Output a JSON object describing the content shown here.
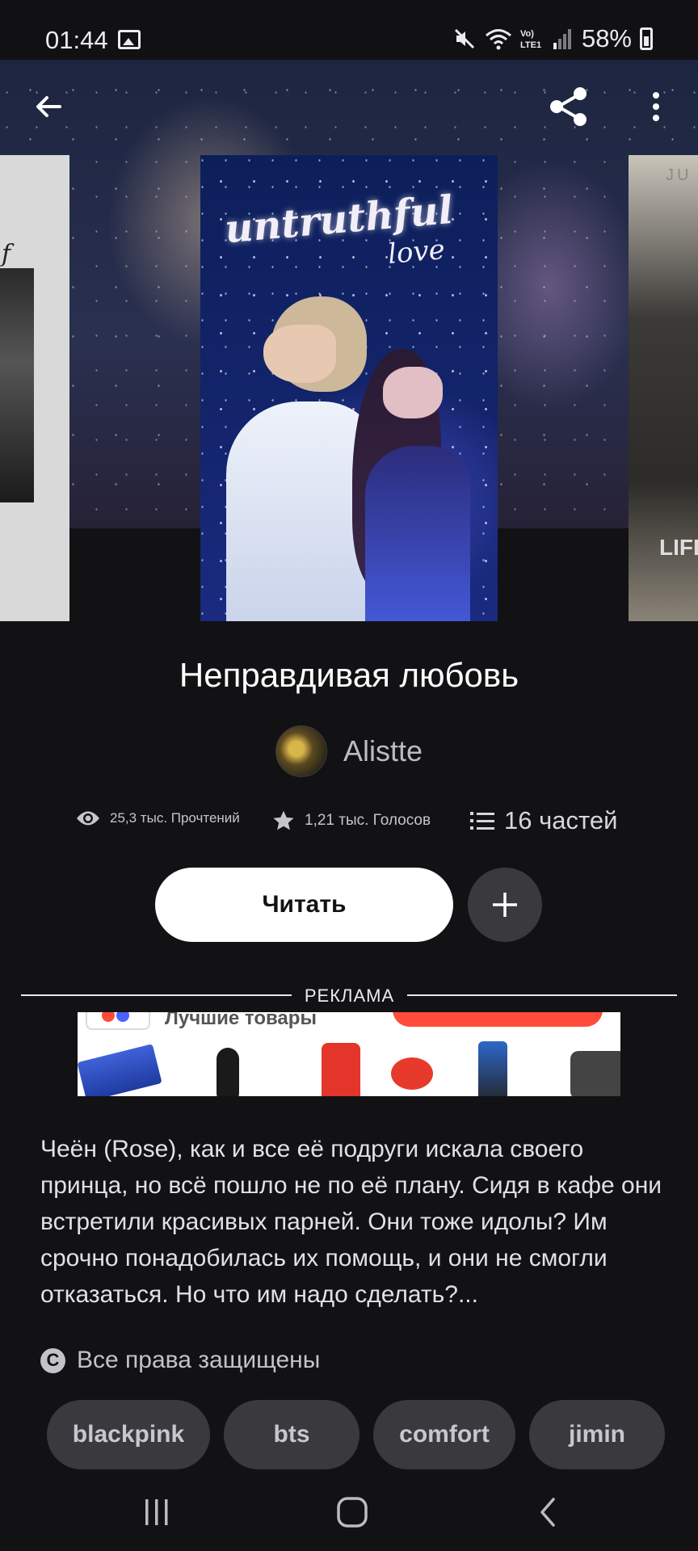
{
  "status_bar": {
    "time": "01:44",
    "battery": "58%"
  },
  "cover": {
    "title_line1": "untruthful",
    "title_line2": "love",
    "right_cover_top": "JU",
    "right_cover_bottom": "LIFE"
  },
  "book": {
    "title": "Неправдивая любовь",
    "author": "Alistte",
    "reads": "25,3 тыс. Прочтений",
    "votes": "1,21 тыс. Голосов",
    "parts": "16 частей",
    "read_button": "Читать",
    "description": "Чеён (Rose), как и все её подруги искала своего принца, но всё пошло не по её плану. Сидя в кафе они встретили красивых парней. Они тоже идолы? Им срочно понадобилась их помощь, и они не смогли отказаться. Но что им надо сделать?...",
    "rights": "Все права защищены",
    "tags": [
      "blackpink",
      "bts",
      "comfort",
      "jimin"
    ]
  },
  "ad": {
    "label": "РЕКЛАМА",
    "headline": "Лучшие товары"
  },
  "icons": {
    "back": "arrow-left-icon",
    "share": "share-icon",
    "menu": "more-vertical-icon",
    "reads": "eye-icon",
    "votes": "star-icon",
    "parts": "list-icon",
    "add": "plus-icon",
    "copyright": "copyright-icon"
  },
  "colors": {
    "background": "#121114",
    "text": "#ffffff",
    "muted": "#c7c5cc",
    "pill": "#3a393e"
  }
}
